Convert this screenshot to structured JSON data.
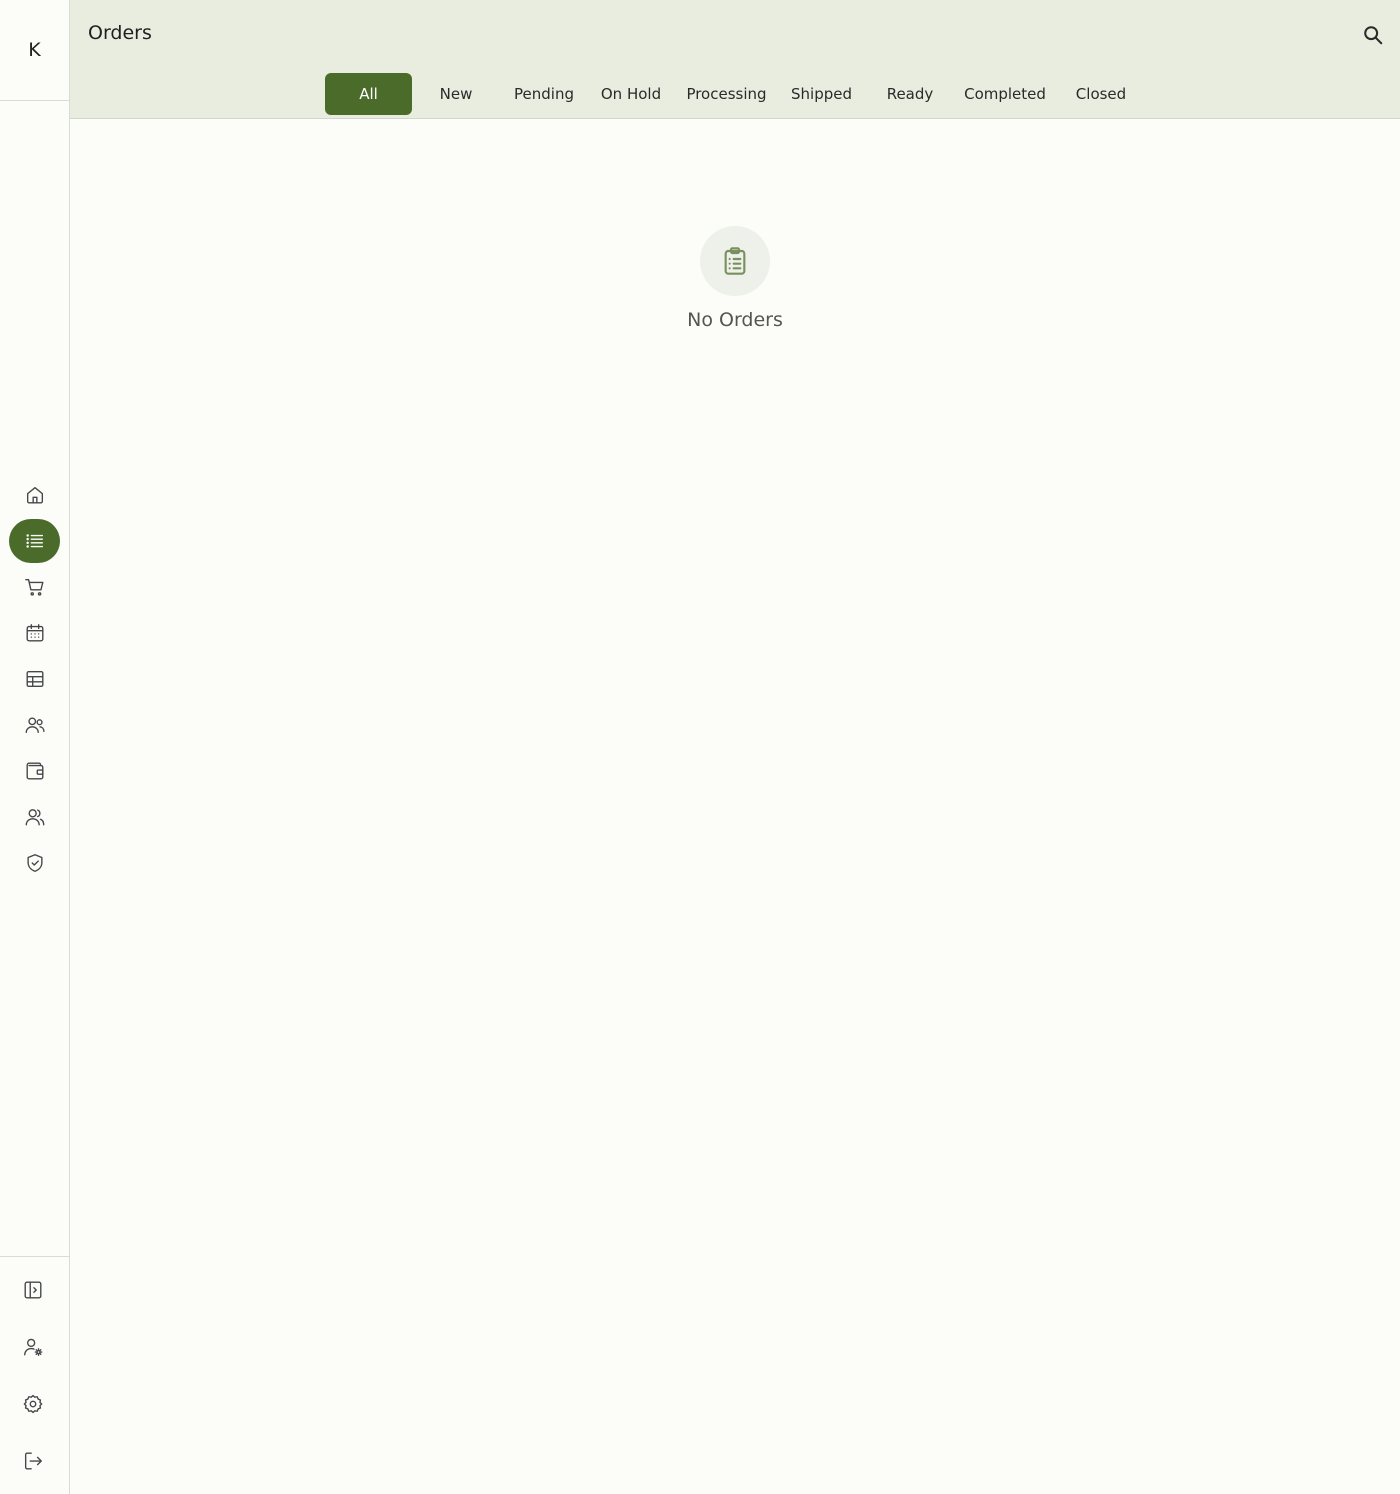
{
  "sidebar": {
    "logo": "K",
    "nav_items": [
      {
        "icon": "home-icon"
      },
      {
        "icon": "list-icon",
        "active": true
      },
      {
        "icon": "cart-icon"
      },
      {
        "icon": "calendar-icon"
      },
      {
        "icon": "table-icon"
      },
      {
        "icon": "users-icon"
      },
      {
        "icon": "wallet-icon"
      },
      {
        "icon": "team-icon"
      },
      {
        "icon": "shield-check-icon"
      }
    ],
    "bottom_items": [
      {
        "icon": "sidebar-toggle-icon"
      },
      {
        "icon": "user-settings-icon"
      },
      {
        "icon": "gear-icon"
      },
      {
        "icon": "logout-icon"
      }
    ]
  },
  "header": {
    "title": "Orders",
    "search_icon": "search-icon",
    "tabs": [
      {
        "label": "All",
        "active": true
      },
      {
        "label": "New"
      },
      {
        "label": "Pending"
      },
      {
        "label": "On Hold"
      },
      {
        "label": "Processing"
      },
      {
        "label": "Shipped"
      },
      {
        "label": "Ready"
      },
      {
        "label": "Completed"
      },
      {
        "label": "Closed"
      }
    ]
  },
  "empty_state": {
    "icon": "clipboard-list-icon",
    "message": "No Orders"
  },
  "colors": {
    "accent": "#4a6b2a",
    "header_bg": "#e8ede0",
    "page_bg": "#fcfcf8"
  }
}
